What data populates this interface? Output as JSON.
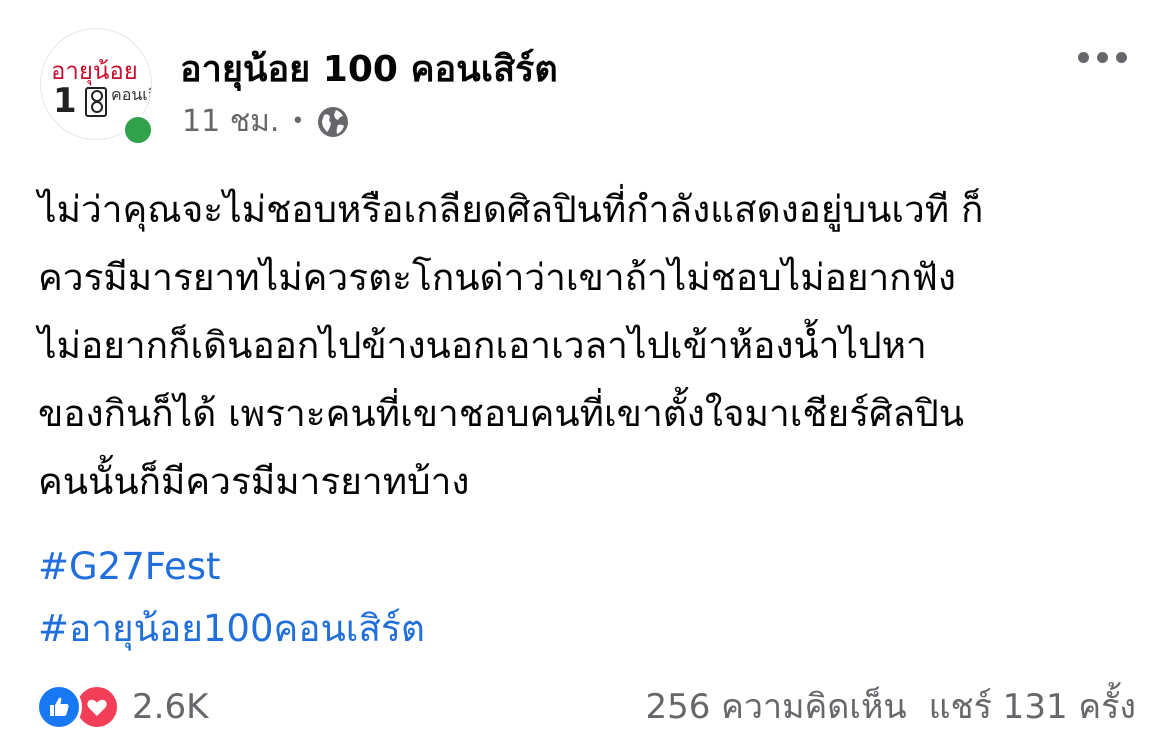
{
  "header": {
    "page_name": "อายุน้อย 100 คอนเสิร์ต",
    "timestamp": "11 ชม.",
    "separator": "•",
    "privacy_icon": "globe-icon",
    "more_icon": "more-options-icon",
    "online_color": "#31a24c",
    "avatar": {
      "logo_text": "อายุน้อย",
      "logo_number": "100",
      "logo_side_text": "คอนเสิร์ต"
    }
  },
  "post": {
    "text": "ไม่ว่าคุณจะไม่ชอบหรือเกลียดศิลปินที่กำลังแสดงอยู่บนเวที ก็\nควรมีมารยาทไม่ควรตะโกนด่าว่าเขาถ้าไม่ชอบไม่อยากฟัง\nไม่อยากก็เดินออกไปข้างนอกเอาเวลาไปเข้าห้องน้ำไปหา\nของกินก็ได้ เพราะคนที่เขาชอบคนที่เขาตั้งใจมาเชียร์ศิลปิน\nคนนั้นก็มีควรมีมารยาทบ้าง",
    "hashtags": [
      "#G27Fest",
      "#อายุน้อย100คอนเสิร์ต"
    ],
    "link_color": "#216fdb"
  },
  "footer": {
    "reaction_icons": [
      "like-icon",
      "love-icon"
    ],
    "reaction_count": "2.6K",
    "comments": "256 ความคิดเห็น",
    "shares": "แชร์ 131 ครั้ง"
  }
}
